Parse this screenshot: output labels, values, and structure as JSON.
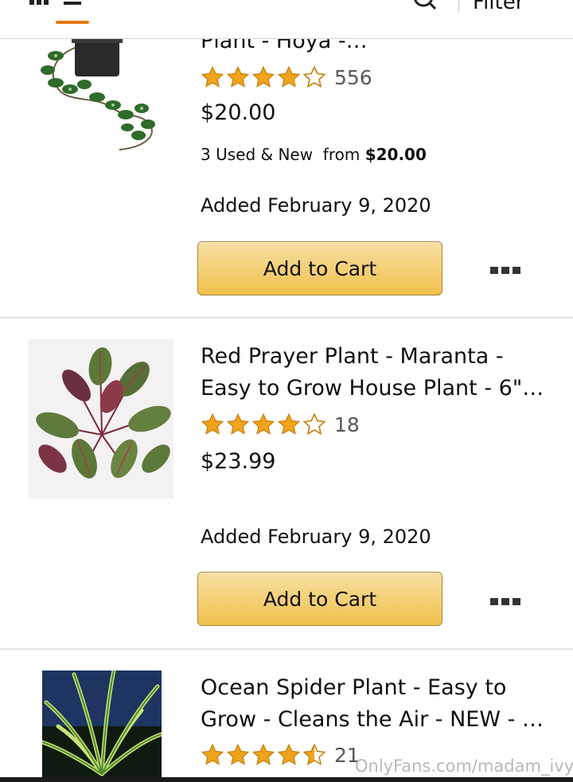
{
  "header": {
    "filter_label": "Filter"
  },
  "items": [
    {
      "title_lines": [
        "Plant - Hoya -…"
      ],
      "rating_stars": 4,
      "rating_count": "556",
      "price": "$20.00",
      "offers_prefix": "3 Used & New  from ",
      "offers_price": "$20.00",
      "added": "Added February 9, 2020",
      "cart_label": "Add to Cart"
    },
    {
      "title_lines": [
        "Red Prayer Plant - Maranta -",
        "Easy to Grow House Plant - 6\"…"
      ],
      "rating_stars": 4,
      "rating_count": "18",
      "price": "$23.99",
      "added": "Added February 9, 2020",
      "cart_label": "Add to Cart"
    },
    {
      "title_lines": [
        "Ocean Spider Plant - Easy to",
        "Grow - Cleans the Air - NEW - …"
      ],
      "rating_stars": 4.5,
      "rating_count": "21"
    }
  ],
  "watermark": "OnlyFans.com/madam_ivy_",
  "colors": {
    "star": "#f0a41c",
    "button_top": "#f7dfa5",
    "button_bottom": "#f0c14b",
    "tab_underline": "#e47911"
  }
}
